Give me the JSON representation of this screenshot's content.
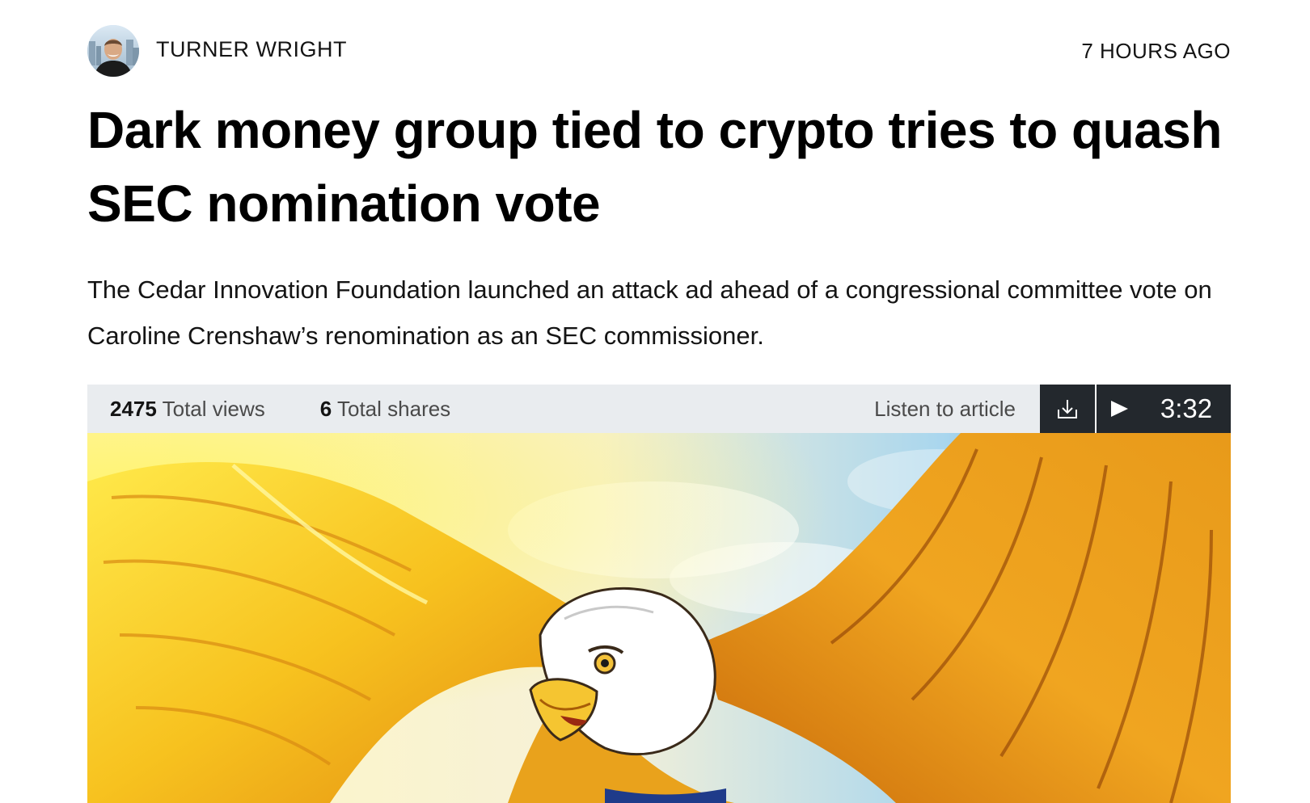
{
  "article": {
    "author": "TURNER WRIGHT",
    "time_ago": "7 HOURS AGO",
    "headline": "Dark money group tied to crypto tries to quash SEC nomination vote",
    "lede": "The Cedar Innovation Foundation launched an attack ad ahead of a congressional committee vote on Caroline Crenshaw’s renomination as an SEC commissioner."
  },
  "stats": {
    "views_count": "2475",
    "views_label": "Total views",
    "shares_count": "6",
    "shares_label": "Total shares"
  },
  "audio": {
    "listen_label": "Listen to article",
    "duration": "3:32",
    "download_icon": "download-icon",
    "play_icon": "play-icon"
  },
  "colors": {
    "stats_bar_bg": "#e9ecef",
    "player_bg": "#23282d",
    "headline": "#000000"
  }
}
